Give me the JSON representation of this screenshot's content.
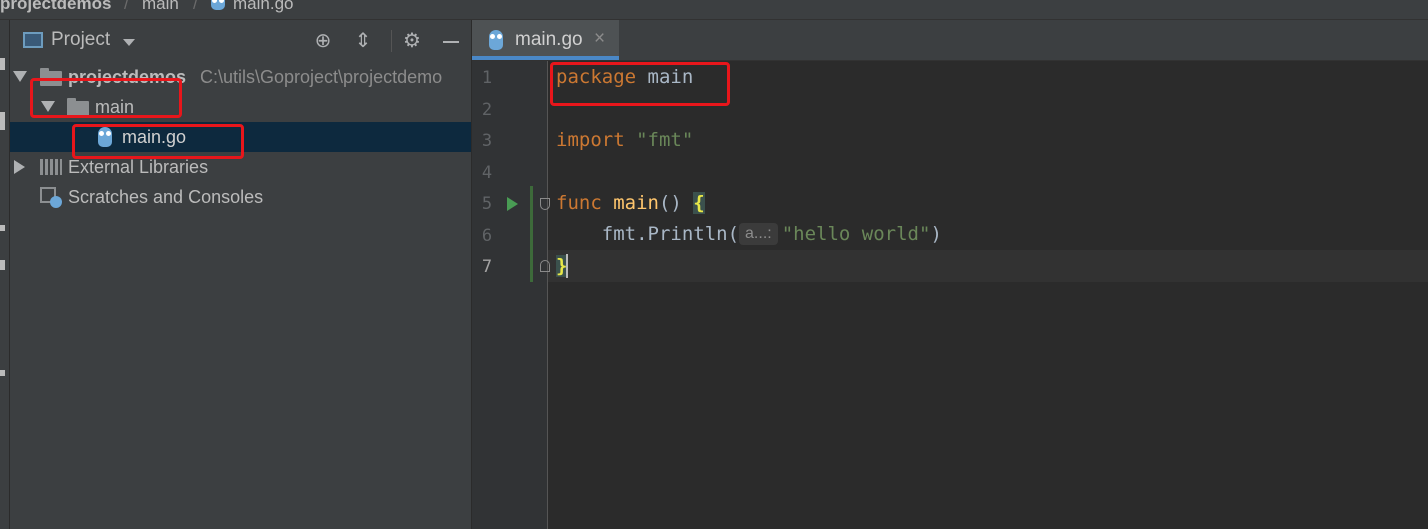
{
  "breadcrumb": {
    "project": "projectdemos",
    "folder": "main",
    "file": "main.go"
  },
  "panel": {
    "title": "Project"
  },
  "tree": {
    "root_name": "projectdemos",
    "root_path": "C:\\utils\\Goproject\\projectdemo",
    "folder": "main",
    "file": "main.go",
    "external": "External Libraries",
    "scratches": "Scratches and Consoles"
  },
  "editor": {
    "tab_label": "main.go",
    "tab_close": "×",
    "line_numbers": [
      "1",
      "2",
      "3",
      "4",
      "5",
      "6",
      "7"
    ],
    "code": {
      "l1_kw": "package",
      "l1_rest": " main",
      "l3_kw": "import",
      "l3_str": " \"fmt\"",
      "l5_kw": "func",
      "l5_fn": " main",
      "l5_rest": "() ",
      "l5_brace": "{",
      "l6_pre": "    fmt.Println(",
      "l6_hint": "a...:",
      "l6_str": "\"hello world\"",
      "l6_post": ")",
      "l7_brace": "}"
    }
  },
  "icons": {
    "panel": "project-window-icon",
    "dropdown": "chevron-down-icon",
    "locate": "crosshair-icon",
    "collapse": "collapse-all-icon",
    "settings": "gear-icon",
    "hide": "minimize-icon",
    "run": "run-gutter-icon",
    "file": "go-file-icon"
  },
  "colors": {
    "highlight_box": "#e8161b",
    "selection": "#0d293e",
    "accent": "#4a88c7"
  }
}
